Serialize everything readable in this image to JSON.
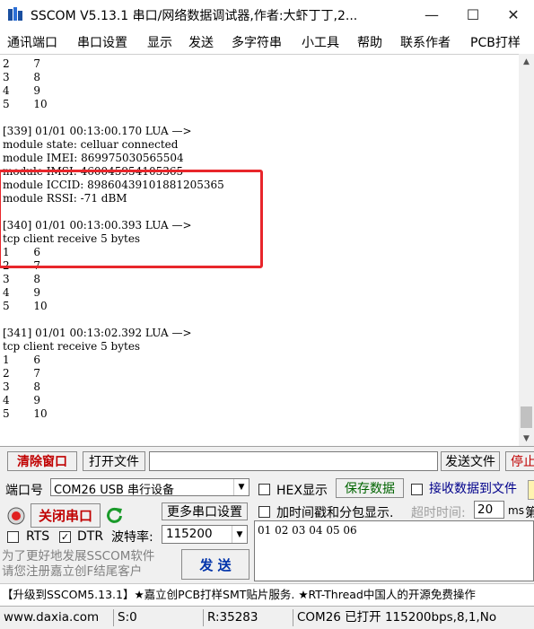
{
  "window": {
    "title": "SSCOM V5.13.1 串口/网络数据调试器,作者:大虾丁丁,2...",
    "minimize_glyph": "—",
    "maximize_glyph": "☐",
    "close_glyph": "✕"
  },
  "menu": [
    "通讯端口",
    "串口设置",
    "显示",
    "发送",
    "多字符串",
    "小工具",
    "帮助",
    "联系作者",
    "PCB打样"
  ],
  "terminal": {
    "lines": [
      "2       7",
      "3       8",
      "4       9",
      "5       10",
      "",
      "[339] 01/01 00:13:00.170 LUA —>",
      "module state: celluar connected",
      "module IMEI: 869975030565504",
      "module IMSI: 460045954105365",
      "module ICCID: 89860439101881205365",
      "module RSSI: -71 dBM",
      "",
      "[340] 01/01 00:13:00.393 LUA —>",
      "tcp client receive 5 bytes",
      "1       6",
      "2       7",
      "3       8",
      "4       9",
      "5       10",
      "",
      "[341] 01/01 00:13:02.392 LUA —>",
      "tcp client receive 5 bytes",
      "1       6",
      "2       7",
      "3       8",
      "4       9",
      "5       10"
    ]
  },
  "toolbar": {
    "clear_window": "清除窗口",
    "open_file": "打开文件",
    "send_file": "发送文件",
    "stop": "停止"
  },
  "port": {
    "label": "端口号",
    "value": "COM26 USB 串行设备",
    "close_port": "关闭串口",
    "more_settings": "更多串口设置",
    "rts_label": "RTS",
    "dtr_label": "DTR",
    "rts_checked": false,
    "dtr_checked": true,
    "baud_label": "波特率:",
    "baud_value": "115200"
  },
  "display": {
    "hex_display": "HEX显示",
    "save_data": "保存数据",
    "recv_to_file": "接收数据到文件",
    "timestamp": "加时间戳和分包显示.",
    "timeout_label": "超时时间:",
    "timeout_value": "20",
    "timeout_unit": "ms",
    "timeout_extra": "第"
  },
  "send": {
    "content": "01 02 03 04 05 06",
    "button": "发 送"
  },
  "promo": {
    "line1": "为了更好地发展SSCOM软件",
    "line2": "请您注册嘉立创F结尾客户"
  },
  "ad_text": "【升级到SSCOM5.13.1】★嘉立创PCB打样SMT贴片服务. ★RT-Thread中国人的开源免费操作",
  "statusbar": {
    "website": "www.daxia.com",
    "sent": "S:0",
    "received": "R:35283",
    "port_status": "COM26 已打开  115200bps,8,1,No"
  },
  "colors": {
    "highlight_border": "#e8262b",
    "clear_button_text": "#c00000",
    "save_data_text": "#006400",
    "recv_file_text": "#00008b"
  }
}
